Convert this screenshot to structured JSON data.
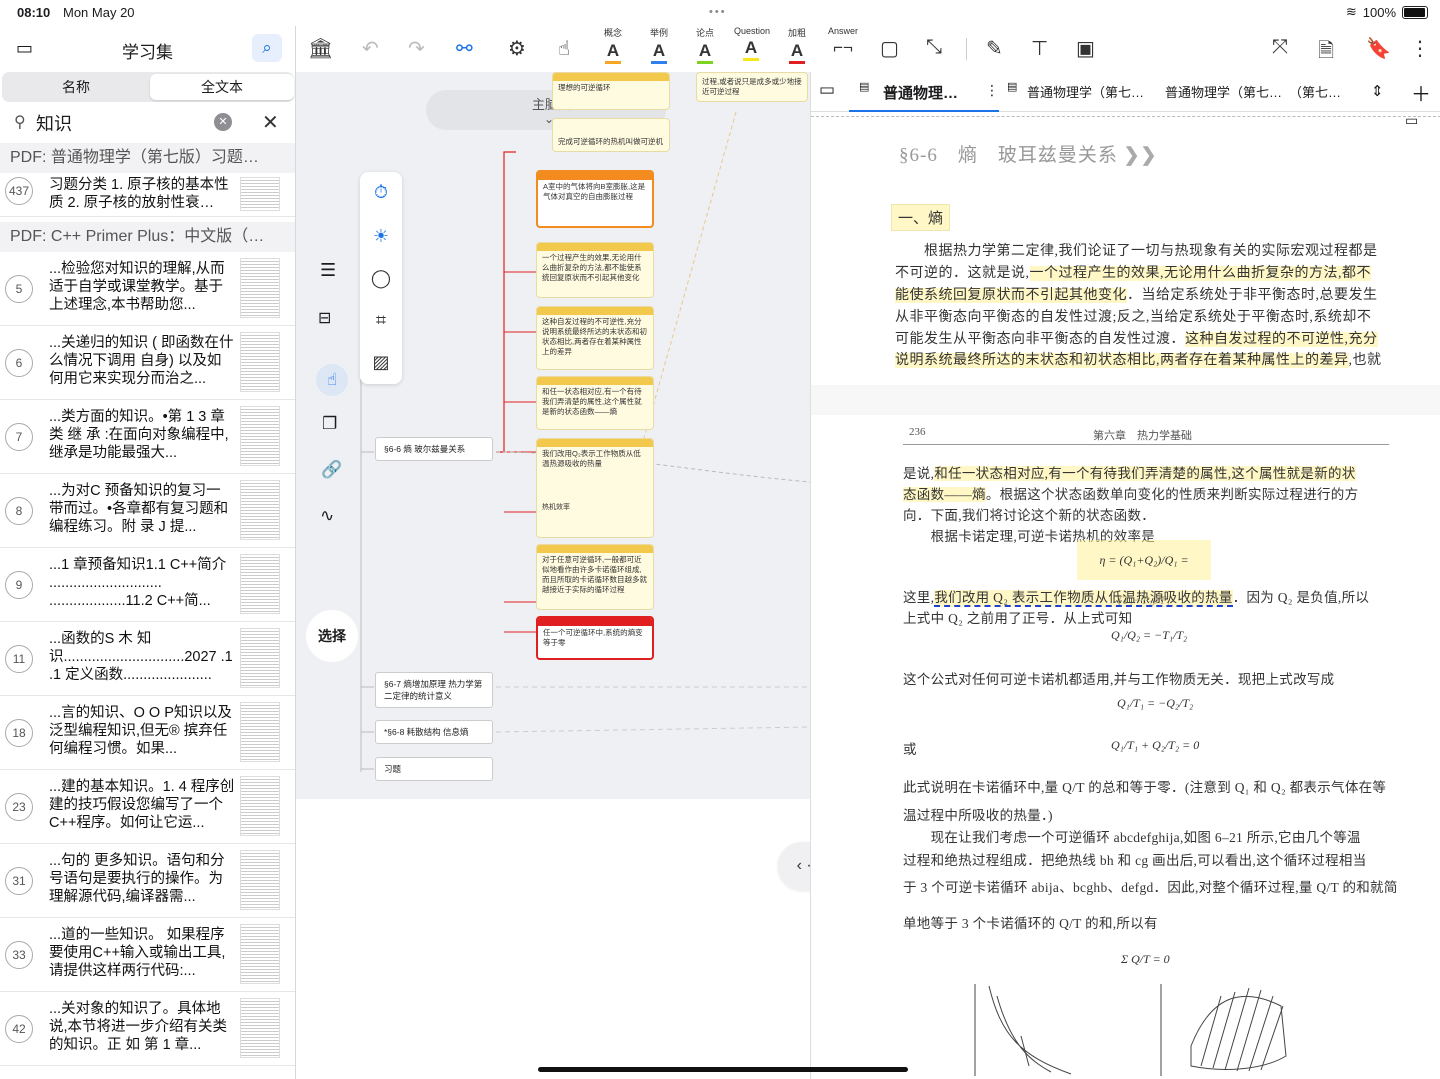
{
  "status": {
    "time": "08:10",
    "date": "Mon May 20",
    "battery": "100%"
  },
  "left": {
    "title": "学习集",
    "seg": [
      "名称",
      "全文本"
    ],
    "query": "知识",
    "sections": [
      "PDF: 普通物理学（第七版）习题…",
      "PDF: C++ Primer Plus：中文版（…"
    ],
    "items": [
      {
        "n": "437",
        "t": "习题分类 1. 原子核的基本性质 2. 原子核的放射性衰…"
      },
      {
        "n": "5",
        "t": "...检验您对知识的理解,从而适于自学或课堂教学。基于上述理念,本书帮助您..."
      },
      {
        "n": "6",
        "t": "...关递归的知识 ( 即函数在什么情况下调用 自身) 以及如何用它来实现分而治之..."
      },
      {
        "n": "7",
        "t": "...类方面的知识。•第 1 3 章 类 继 承 :在面向对象编程中, 继承是功能最强大..."
      },
      {
        "n": "8",
        "t": "...为对C 预备知识的复习一带而过。•各章都有复习题和编程练习。附 录 J 提..."
      },
      {
        "n": "9",
        "t": "...1 章预备知识1.1 C++简介 ............................ ...................11.2 C++简..."
      },
      {
        "n": "11",
        "t": "...函数的S 木 知识..............................2027 .1 .1 定义函数......................"
      },
      {
        "n": "18",
        "t": "...言的知识、O O P知识以及泛型编程知识,但无® 摈弃任 何编程习惯。如果..."
      },
      {
        "n": "23",
        "t": "...建的基本知识。1. 4 程序创建的技巧假设您编写了一个C++程序。如何让它运..."
      },
      {
        "n": "31",
        "t": "...句的 更多知识。语句和分号语句是要执行的操作。为理解源代码,编译器需..."
      },
      {
        "n": "33",
        "t": "...道的一些知识。 如果程序要使用C++输入或输出工具, 请提供这样两行代码:..."
      },
      {
        "n": "42",
        "t": "...关对象的知识了。具体地说,本节将进一步介绍有关类 的知识。正 如 第 1 章..."
      }
    ]
  },
  "toolbar": {
    "hl": [
      {
        "l": "概念",
        "c": "#f5a623"
      },
      {
        "l": "举例",
        "c": "#2f80ed"
      },
      {
        "l": "论点",
        "c": "#7ed321"
      },
      {
        "l": "Question",
        "c": "#f8e71c"
      },
      {
        "l": "加粗",
        "c": "#e02020"
      },
      {
        "l": "Answer",
        "c": "#9b9b9b"
      }
    ]
  },
  "mindmap": {
    "label": "主脑图",
    "select": "选择",
    "main": "§6-6 熵 玻尔兹曼关系",
    "sub": [
      "§6-7 熵增加原理 热力学第二定律的统计意义",
      "*§6-8 耗散结构 信息熵",
      "习题"
    ],
    "top_nodes": [
      "理想的可逆循环",
      "完成可逆循环的热机叫做可逆机",
      "过程,或者说只是成多或少地接近可逆过程"
    ],
    "cards": [
      "A室中的气体将向B室膨胀,这是气体对真空的自由膨胀过程",
      "一个过程产生的效果,无论用什么曲折复杂的方法,都不能使系统回复原状而不引起其他变化",
      "这种自发过程的不可逆性,充分说明系统最终所达的末状态和初状态相比,两者存在着某种属性上的差异",
      "和任一状态相对应,有一个有待我们弄清楚的属性,这个属性就是新的状态函数——熵",
      "我们改用Q₂表示工作物质从低温热源吸收的热量",
      "对于任意可逆循环,一般都可近似地看作由许多卡诺循环组成,而且所取的卡诺循环数目越多就越接近于实际的循环过程",
      "任一个可逆循环中,系统的熵变等于零"
    ],
    "card_sub": [
      "熵(Q₁/Q₂)…",
      "热机效率"
    ]
  },
  "tabs": [
    "普通物理…",
    "普通物理学（第七…",
    "普通物理学（第七…",
    "（第七…"
  ],
  "doc": {
    "heading": "§6-6　熵　玻耳兹曼关系",
    "sub": "一、熵",
    "p1": [
      "　　根据热力学第二定律,我们论证了一切与热现象有关的实际宏观过程都是",
      "不可逆的．这就是说,",
      "一个过程产生的效果,无论用什么曲折复杂的方法,都不",
      "能使系统回复原状而不引起其他变化",
      "．当给定系统处于非平衡态时,总要发生",
      "从非平衡态向平衡态的自发性过渡;反之,当给定系统处于平衡态时,系统却不",
      "可能发生从平衡态向非平衡态的自发性过渡．",
      "这种自发过程的不可逆性,充分",
      "说明系统最终所达的末状态和初状态相比,两者存在着某种属性上的差异",
      ",也就"
    ],
    "pageno": "236",
    "chapter": "第六章　热力学基础",
    "p2": [
      "是说,",
      "和任一状态相对应,有一个有待我们弄清楚的属性,这个属性就是新的状",
      "态函数——熵",
      "。根据这个状态函数单向变化的性质来判断实际过程进行的方",
      "向．下面,我们将讨论这个新的状态函数．",
      "　　根据卡诺定理,可逆卡诺热机的效率是",
      "这里,",
      "我们改用 Q₂ 表示工作物质从低温热源吸收的热量",
      "．因为 Q₂ 是负值,所以",
      "上式中 Q₂ 之前用了正号．从上式可知",
      "这个公式对任何可逆卡诺机都适用,并与工作物质无关．现把上式改写成",
      "或",
      "此式说明在卡诺循环中,量 Q/T 的总和等于零．(注意到 Q₁ 和 Q₂ 都表示气体在等",
      "温过程中所吸收的热量．)",
      "　　现在让我们考虑一个可逆循环 abcdefghija,如图 6–21 所示,它由几个等温",
      "过程和绝热过程组成．把绝热线 bh 和 cg 画出后,可以看出,这个循环过程相当",
      "于 3 个可逆卡诺循环 abija、bcghb、defgd．因此,对整个循环过程,量 Q/T 的和就简",
      "单地等于 3 个卡诺循环的 Q/T 的和,所以有"
    ],
    "f1": "η = (Q₁+Q₂)/Q₁ = (T₁−T₂)/T₁",
    "f2": "Q₁/Q₂ = −T₁/T₂",
    "f3": "Q₁/T₁ = −Q₂/T₂",
    "f4": "Q₁/T₁ + Q₂/T₂ = 0",
    "f5": "Σ Q/T = 0"
  }
}
